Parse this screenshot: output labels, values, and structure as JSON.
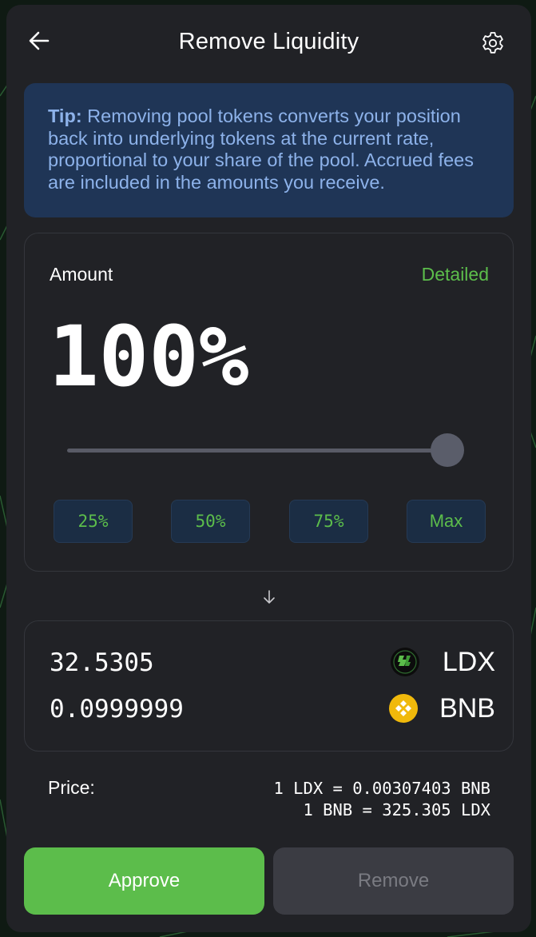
{
  "header": {
    "title": "Remove Liquidity",
    "back_icon": "arrow-left-icon",
    "settings_icon": "gear-icon"
  },
  "tip": {
    "label": "Tip:",
    "text": " Removing pool tokens converts your position back into underlying tokens at the current rate, proportional to your share of the pool. Accrued fees are included in the amounts you receive."
  },
  "amount": {
    "label": "Amount",
    "detailed_label": "Detailed",
    "percent_text": "100%",
    "slider_value": 1.0,
    "quick_buttons": [
      "25%",
      "50%",
      "75%",
      "Max"
    ]
  },
  "receive": {
    "tokens": [
      {
        "amount": "32.5305",
        "symbol": "LDX",
        "icon": "ldx-token-icon"
      },
      {
        "amount": "0.0999999",
        "symbol": "BNB",
        "icon": "bnb-token-icon"
      }
    ]
  },
  "price": {
    "label": "Price:",
    "line1": "1 LDX = 0.00307403 BNB",
    "line2": "1 BNB = 325.305 LDX"
  },
  "actions": {
    "approve_label": "Approve",
    "remove_label": "Remove"
  },
  "colors": {
    "accent_green": "#5cbd4b",
    "tip_background": "#1f3556",
    "tip_text": "#8db2ea",
    "panel_background": "#212226",
    "bnb_yellow": "#f0b90b"
  }
}
